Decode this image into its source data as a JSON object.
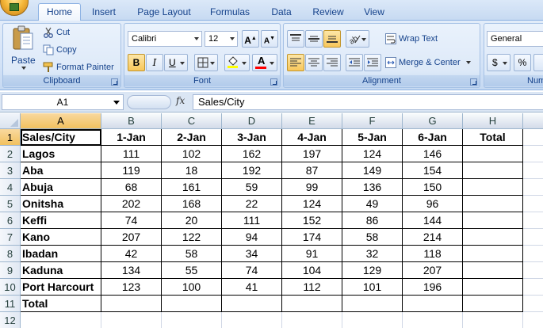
{
  "tabs": [
    "Home",
    "Insert",
    "Page Layout",
    "Formulas",
    "Data",
    "Review",
    "View"
  ],
  "active_tab": "Home",
  "ribbon": {
    "clipboard": {
      "label": "Clipboard",
      "paste": "Paste",
      "cut": "Cut",
      "copy": "Copy",
      "format_painter": "Format Painter"
    },
    "font": {
      "label": "Font",
      "font_name": "Calibri",
      "font_size": "12",
      "bold": "B",
      "italic": "I",
      "underline": "U",
      "grow": "A",
      "shrink": "A",
      "font_color_letter": "A",
      "highlight_color": "#ffff00",
      "font_color": "#ff0000"
    },
    "alignment": {
      "label": "Alignment",
      "wrap_text": "Wrap Text",
      "merge_center": "Merge & Center"
    },
    "number": {
      "label": "Numbe",
      "format": "General",
      "currency": "$",
      "percent": "%"
    }
  },
  "formula_bar": {
    "name_box": "A1",
    "fx": "fx",
    "content": "Sales/City"
  },
  "sheet": {
    "columns": [
      "A",
      "B",
      "C",
      "D",
      "E",
      "F",
      "G",
      "H"
    ],
    "rows": [
      "1",
      "2",
      "3",
      "4",
      "5",
      "6",
      "7",
      "8",
      "9",
      "10",
      "11",
      "12"
    ],
    "header": [
      "Sales/City",
      "1-Jan",
      "2-Jan",
      "3-Jan",
      "4-Jan",
      "5-Jan",
      "6-Jan",
      "Total"
    ],
    "data": [
      [
        "Lagos",
        "111",
        "102",
        "162",
        "197",
        "124",
        "146"
      ],
      [
        "Aba",
        "119",
        "18",
        "192",
        "87",
        "149",
        "154"
      ],
      [
        "Abuja",
        "68",
        "161",
        "59",
        "99",
        "136",
        "150"
      ],
      [
        "Onitsha",
        "202",
        "168",
        "22",
        "124",
        "49",
        "96"
      ],
      [
        "Keffi",
        "74",
        "20",
        "111",
        "152",
        "86",
        "144"
      ],
      [
        "Kano",
        "207",
        "122",
        "94",
        "174",
        "58",
        "214"
      ],
      [
        "Ibadan",
        "42",
        "58",
        "34",
        "91",
        "32",
        "118"
      ],
      [
        "Kaduna",
        "134",
        "55",
        "74",
        "104",
        "129",
        "207"
      ],
      [
        "Port Harcourt",
        "123",
        "100",
        "41",
        "112",
        "101",
        "196"
      ]
    ],
    "total_label": "Total"
  }
}
